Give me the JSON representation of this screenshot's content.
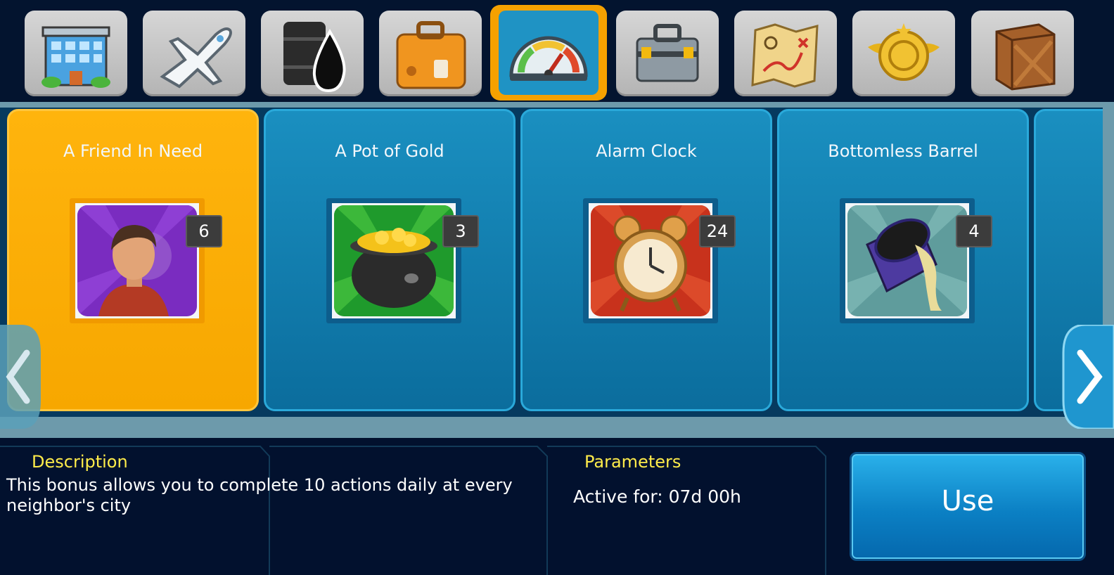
{
  "tabs": [
    {
      "icon": "building-icon"
    },
    {
      "icon": "airplane-icon"
    },
    {
      "icon": "oil-barrel-icon"
    },
    {
      "icon": "suitcase-icon"
    },
    {
      "icon": "speedometer-icon",
      "active": true
    },
    {
      "icon": "toolbox-icon"
    },
    {
      "icon": "treasure-map-icon"
    },
    {
      "icon": "gold-medal-icon"
    },
    {
      "icon": "wooden-crate-icon"
    }
  ],
  "cards": [
    {
      "title": "A Friend In Need",
      "count": "6",
      "icon": "friend-icon",
      "selected": true
    },
    {
      "title": "A Pot of Gold",
      "count": "3",
      "icon": "pot-of-gold-icon"
    },
    {
      "title": "Alarm Clock",
      "count": "24",
      "icon": "alarm-clock-icon"
    },
    {
      "title": "Bottomless Barrel",
      "count": "4",
      "icon": "bottomless-barrel-icon"
    }
  ],
  "description": {
    "heading": "Description",
    "text": "This bonus allows you to complete 10 actions daily at every neighbor's city"
  },
  "parameters": {
    "heading": "Parameters",
    "active_for": "Active for: 07d 00h"
  },
  "use_button": "Use",
  "colors": {
    "selected_card": "#f7a700",
    "card": "#1a8fc0",
    "heading": "#ffec4a"
  }
}
